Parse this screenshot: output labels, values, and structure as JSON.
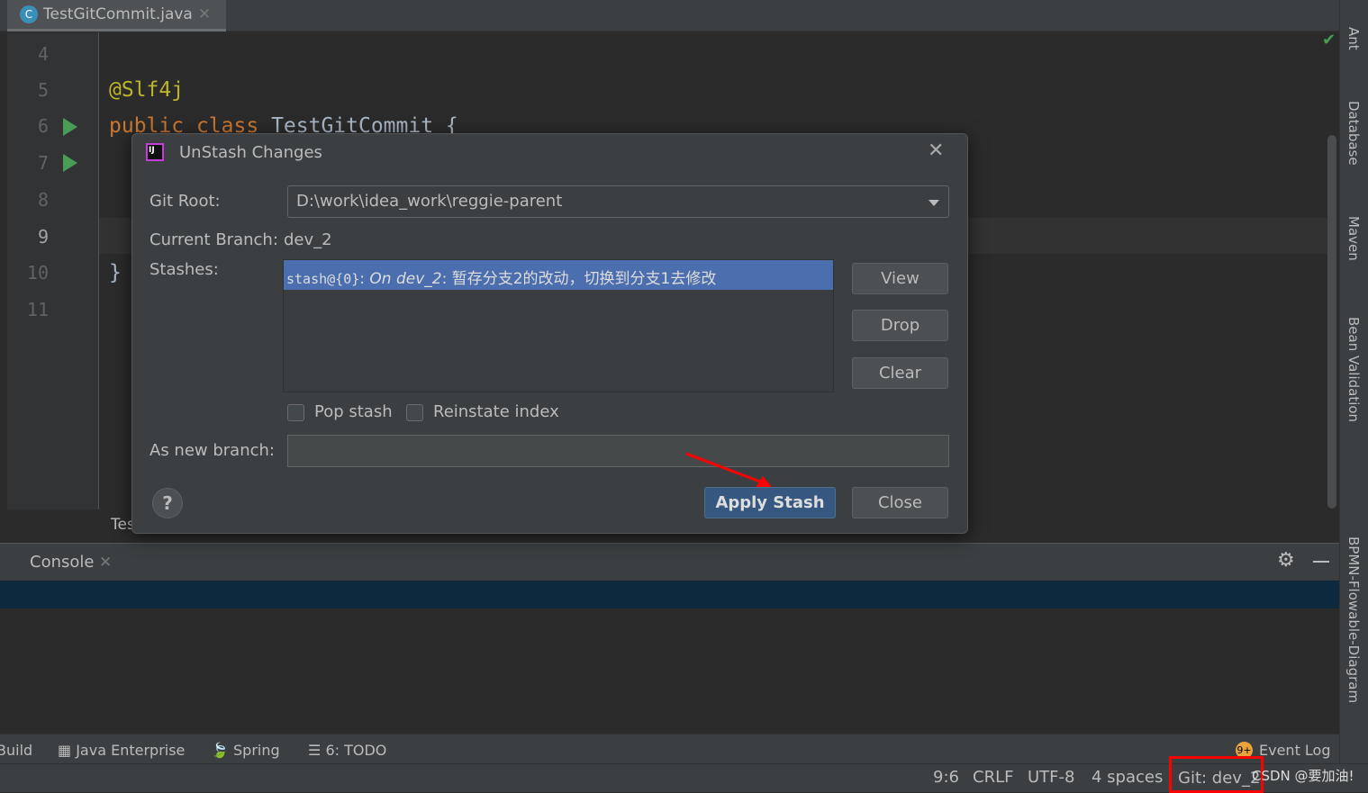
{
  "editor": {
    "tab_title": "TestGitCommit.java",
    "tab_icon": "C",
    "line_numbers": [
      "4",
      "5",
      "6",
      "7",
      "8",
      "9",
      "10",
      "11"
    ],
    "code": {
      "annotation": "@Slf4j",
      "kw1": "public",
      "kw2": "class",
      "classname": "TestGitCommit {",
      "close_brace": "}"
    },
    "bottom_tab_fragment": "Tes"
  },
  "right_sidebar": [
    "Ant",
    "Database",
    "Maven",
    "Bean Validation",
    "BPMN-Flowable-Diagram"
  ],
  "dialog": {
    "title": "UnStash Changes",
    "git_root_label": "Git Root:",
    "git_root_value": "D:\\work\\idea_work\\reggie-parent",
    "current_branch_label": "Current Branch:",
    "current_branch_value": "dev_2",
    "stashes_label": "Stashes:",
    "stashes": [
      {
        "ref": "stash@{0}",
        "sep": ": ",
        "branch": "On dev_2",
        "message": ": 暂存分支2的改动，切换到分支1去修改"
      }
    ],
    "buttons": {
      "view": "View",
      "drop": "Drop",
      "clear": "Clear",
      "apply": "Apply Stash",
      "close": "Close",
      "help": "?"
    },
    "pop_stash": "Pop stash",
    "reinstate_index": "Reinstate index",
    "new_branch_label": "As new branch:",
    "new_branch_value": ""
  },
  "console": {
    "tab": "Console"
  },
  "toolstrip": [
    "Build",
    "Java Enterprise",
    "Spring",
    "6: TODO"
  ],
  "event_log": {
    "badge": "9+",
    "label": "Event Log"
  },
  "status": {
    "position": "9:6",
    "line_sep": "CRLF",
    "encoding": "UTF-8",
    "indent": "4 spaces",
    "git": "Git: dev_2",
    "watermark": "CSDN @要加油!"
  },
  "colors": {
    "accent": "#365880",
    "selection": "#4b6eaf",
    "highlight_box": "#ff0000",
    "arrow": "#ff0000"
  }
}
